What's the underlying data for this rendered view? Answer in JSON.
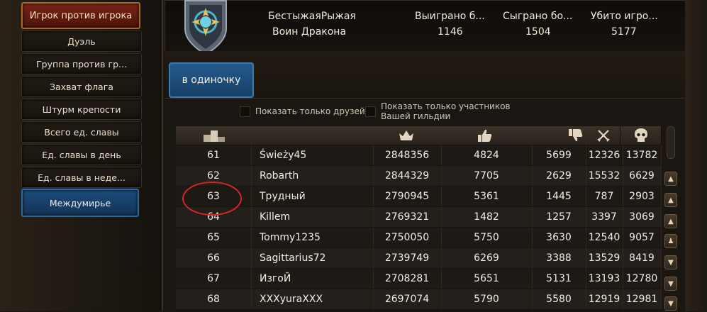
{
  "sidebar": {
    "items": [
      {
        "label": "Игрок против игрока",
        "style": "red"
      },
      {
        "label": "Дуэль",
        "style": "normal"
      },
      {
        "label": "Группа против гр...",
        "style": "normal"
      },
      {
        "label": "Захват флага",
        "style": "normal"
      },
      {
        "label": "Штурм крепости",
        "style": "normal"
      },
      {
        "label": "Всего ед. славы",
        "style": "normal"
      },
      {
        "label": "Ед. славы в день",
        "style": "normal"
      },
      {
        "label": "Ед. славы в неде...",
        "style": "normal"
      },
      {
        "label": "Междумирье",
        "style": "blue"
      }
    ]
  },
  "header": {
    "player_name": "БестыжаяРыжая",
    "player_title": "Воин Дракона",
    "stats": [
      {
        "label": "Выиграно б...",
        "value": "1146"
      },
      {
        "label": "Сыграно бо...",
        "value": "1504"
      },
      {
        "label": "Убито игро...",
        "value": "5177"
      }
    ]
  },
  "tabs": {
    "solo": "в одиночку"
  },
  "filters": {
    "friends_only": "Показать только друзей",
    "guild_only_line1": "Показать только участников",
    "guild_only_line2": "Вашей гильдии"
  },
  "table": {
    "columns": [
      "rank-icon",
      "name",
      "crown-icon",
      "thumbs-up-icon",
      "thumbs-down-icon",
      "crossed-swords-icon",
      "skull-icon"
    ],
    "rows": [
      [
        "61",
        "Świeży45",
        "2848356",
        "4824",
        "5699",
        "12326",
        "13782"
      ],
      [
        "62",
        "Robarth",
        "2844329",
        "7705",
        "2629",
        "15532",
        "6629"
      ],
      [
        "63",
        "Трудный",
        "2790945",
        "5361",
        "1445",
        "787",
        "2903"
      ],
      [
        "64",
        "Killem",
        "2769321",
        "1482",
        "1257",
        "3397",
        "3069"
      ],
      [
        "65",
        "Tommy1235",
        "2750050",
        "5750",
        "3630",
        "12540",
        "9057"
      ],
      [
        "66",
        "Sagittarius72",
        "2739749",
        "6269",
        "3388",
        "13529",
        "8419"
      ],
      [
        "67",
        "ИзгоЙ",
        "2708281",
        "5651",
        "5131",
        "13193",
        "12780"
      ],
      [
        "68",
        "XXXyuraXXX",
        "2697074",
        "5790",
        "5580",
        "12919",
        "12981"
      ]
    ],
    "highlighted_rank": "63"
  },
  "colors": {
    "accent_red": "#d4252b",
    "tab_blue": "#245a8c",
    "menu_red": "#7a2414"
  }
}
